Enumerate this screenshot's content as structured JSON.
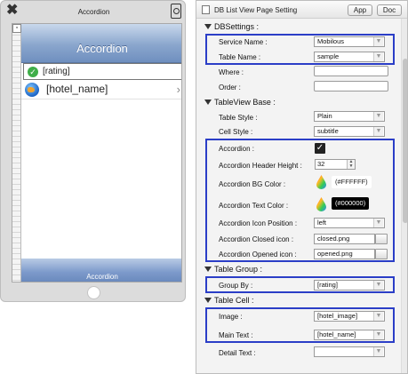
{
  "simulator": {
    "window_title": "Accordion",
    "nav_title": "Accordion",
    "group_row_text": "[rating]",
    "cell_text": "[hotel_name]",
    "tab_label": "Accordion"
  },
  "panel": {
    "title": "DB List View Page Setting",
    "app_button": "App",
    "doc_button": "Doc",
    "db_settings": {
      "header": "DBSettings :",
      "service_name_label": "Service Name :",
      "service_name_value": "Mobilous",
      "table_name_label": "Table Name :",
      "table_name_value": "sample",
      "where_label": "Where :",
      "where_value": "",
      "order_label": "Order :",
      "order_value": ""
    },
    "tableview_base": {
      "header": "TableView Base :",
      "table_style_label": "Table Style :",
      "table_style_value": "Plain",
      "cell_style_label": "Cell Style :",
      "cell_style_value": "subtitle",
      "accordion_label": "Accordion :",
      "accordion_checked": true,
      "accordion_header_height_label": "Accordion Header Height :",
      "accordion_header_height_value": "32",
      "accordion_bg_color_label": "Accordion BG Color :",
      "accordion_bg_color_value": "(#FFFFFF)",
      "accordion_text_color_label": "Accordion Text Color :",
      "accordion_text_color_value": "(#000000)",
      "accordion_icon_position_label": "Accordion Icon Position :",
      "accordion_icon_position_value": "left",
      "accordion_closed_icon_label": "Accordion Closed icon :",
      "accordion_closed_icon_value": "closed.png",
      "accordion_opened_icon_label": "Accordion Opened icon :",
      "accordion_opened_icon_value": "opened.png"
    },
    "table_group": {
      "header": "Table Group :",
      "group_by_label": "Group By :",
      "group_by_value": "[rating]"
    },
    "table_cell": {
      "header": "Table Cell :",
      "image_label": "Image :",
      "image_value": "[hotel_image]",
      "main_text_label": "Main Text :",
      "main_text_value": "[hotel_name]",
      "detail_text_label": "Detail Text :",
      "detail_text_value": ""
    }
  },
  "colors": {
    "highlight_border": "#2b3ec7",
    "nav_bar": "#8aa6cd",
    "group_check": "#3fae49"
  },
  "icons": [
    "close-icon",
    "preview-icon",
    "check-circle-icon",
    "globe-icon",
    "chevron-right-icon",
    "color-drop-icon",
    "document-icon"
  ]
}
